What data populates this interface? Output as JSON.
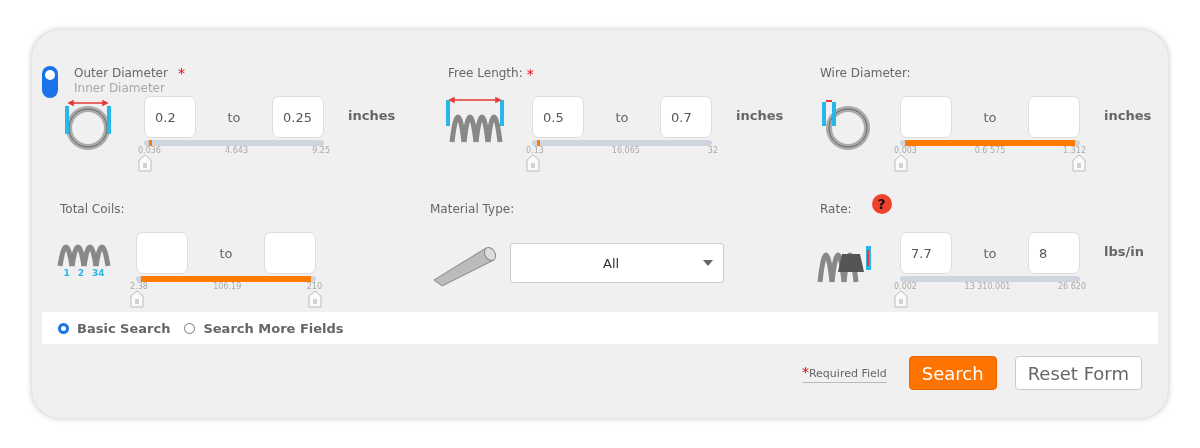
{
  "fields": [
    {
      "kind": "toggle",
      "options": [
        {
          "label": "Outer Diameter",
          "selected": true
        },
        {
          "label": "Inner Diameter",
          "selected": false
        }
      ],
      "required": true,
      "min_value": "0.2",
      "to_label": "to",
      "max_value": "0.25",
      "unit": "inches",
      "ticks": [
        "0.036",
        "4.643",
        "9.25"
      ],
      "level": 0.02
    },
    {
      "kind": "range",
      "label": "Free Length:",
      "required": true,
      "min_value": "0.5",
      "to_label": "to",
      "max_value": "0.7",
      "unit": "inches",
      "ticks": [
        "0.13",
        "16.065",
        "32"
      ],
      "level": 0.02
    },
    {
      "kind": "range",
      "label": "Wire Diameter:",
      "required": false,
      "to_label": "to",
      "unit": "inches",
      "ticks": [
        "0.003",
        "0.6 575",
        "1.312"
      ],
      "level": 1
    },
    {
      "kind": "range",
      "label": "Total Coils:",
      "required": false,
      "icon_labels": [
        "1",
        "2",
        "34"
      ],
      "to_label": "to",
      "ticks": [
        "2.38",
        "106.19",
        "210"
      ],
      "level": 1
    },
    {
      "kind": "select",
      "label": "Material Type:",
      "required": false,
      "value": "All"
    },
    {
      "kind": "range",
      "label": "Rate:",
      "required": false,
      "help": "?",
      "min_value": "7.7",
      "to_label": "to",
      "max_value": "8",
      "unit": "lbs/in",
      "ticks": [
        "0.002",
        "13 310.001",
        "26 620"
      ]
    }
  ],
  "search_modes": [
    {
      "label": "Basic Search",
      "selected": true
    },
    {
      "label": "Search More Fields",
      "selected": false
    }
  ],
  "required_note": {
    "mark": "*",
    "text": "Required Field"
  },
  "buttons": [
    {
      "kind": "primary",
      "label": "Search"
    },
    {
      "kind": "secondary",
      "label": "Reset Form"
    }
  ]
}
